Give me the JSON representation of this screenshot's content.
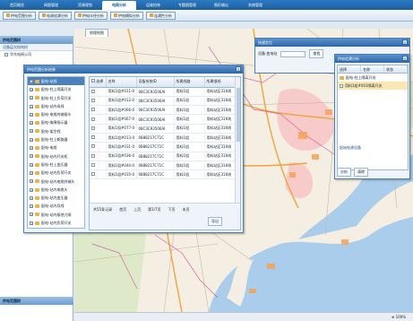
{
  "topnav": {
    "tabs": [
      {
        "label": "首页概览",
        "active": false
      },
      {
        "label": "网图管理",
        "active": false
      },
      {
        "label": "资源规划",
        "active": false
      },
      {
        "label": "电网分析",
        "active": true
      },
      {
        "label": "运维检修",
        "active": false
      },
      {
        "label": "专题图管理",
        "active": false
      },
      {
        "label": "图形输出",
        "active": false
      },
      {
        "label": "系统管理",
        "active": false
      }
    ]
  },
  "subbar": {
    "buttons": [
      "供电范围分析",
      "电源追溯分析",
      "供电半径分析",
      "供电模拟分析",
      "连通性分析"
    ]
  },
  "leftpanel": {
    "title": "供电范围树",
    "sub": "设备层次结构树",
    "item": "华东电网公司",
    "footer": "供电范围树"
  },
  "map": {
    "tab": "地理地图",
    "zoom": "100%"
  },
  "main_dialog": {
    "title": "供电范围分析结果",
    "tree": [
      {
        "label": "配电-站线",
        "selected": true
      },
      {
        "label": "配电-柱上隔离开关",
        "selected": false
      },
      {
        "label": "配电-柱上负荷开关",
        "selected": false
      },
      {
        "label": "配电-站内母线",
        "selected": false
      },
      {
        "label": "配电-电缆终端接头",
        "selected": false
      },
      {
        "label": "配电-故障指示器",
        "selected": false
      },
      {
        "label": "配电-架空线",
        "selected": false
      },
      {
        "label": "配电-柱上断路器",
        "selected": false
      },
      {
        "label": "配电-电缆",
        "selected": false
      },
      {
        "label": "配电-站内开关柜",
        "selected": false
      },
      {
        "label": "配电-柱上变压器",
        "selected": false
      },
      {
        "label": "配电-站内负荷开关",
        "selected": false
      },
      {
        "label": "配电-站内电缆终端头",
        "selected": false
      },
      {
        "label": "配电-站内电缆头",
        "selected": false
      },
      {
        "label": "配电-站内变压器",
        "selected": false
      },
      {
        "label": "配电-站内导线",
        "selected": false
      },
      {
        "label": "配电-站内接地刀闸",
        "selected": false
      },
      {
        "label": "配电-站内负荷开关",
        "selected": false
      }
    ],
    "columns": [
      "选择",
      "名称",
      "设备系统ID",
      "所属线路",
      "所属馈线"
    ],
    "rows": [
      [
        "用料1组#011-0",
        "08C3C93506AI",
        "用料1组",
        "用料站区316线"
      ],
      [
        "用料1组#012-0",
        "08C3C93506AI",
        "用料1组",
        "用料站区316线"
      ],
      [
        "用料1组#066-0",
        "08C3C93506AI",
        "用料1组",
        "用料站区316线"
      ],
      [
        "用料1组#067-0",
        "08C3C93506AI",
        "用料1组",
        "用料站区316线"
      ],
      [
        "用料1组#077-0",
        "08C3C93506AI",
        "用料1组",
        "用料站区316线"
      ],
      [
        "用料1组#013-0",
        "0888217C71C",
        "用料1组",
        "用料站区316线"
      ],
      [
        "用料1组#031-0",
        "0888217C71C",
        "用料1组",
        "用料站区316线"
      ],
      [
        "用料1组#036-0",
        "0888217C71C",
        "用料1组",
        "用料站区316线"
      ],
      [
        "用料1组#040-0",
        "0888217C71C",
        "用料1组",
        "用料站区316线"
      ],
      [
        "用料1组#035-0",
        "0888217C71C",
        "用料1组",
        "用料站区316线"
      ]
    ],
    "pager": {
      "total": "共55条记录",
      "first": "首页",
      "prev": "上页",
      "page": "第1/7页",
      "next": "下页",
      "last": "末页",
      "export": "导出"
    }
  },
  "right_dialog_1": {
    "title": "快速定位",
    "label": "设备:变电站",
    "button": "查找"
  },
  "right_dialog_2": {
    "title": "供电追溯分析",
    "columns": [
      "选择",
      "名称",
      "状态"
    ],
    "rows": [
      {
        "label": "配电-柱上隔离开关",
        "selected": false
      },
      {
        "label": "用料1组#001隔离开关",
        "selected": true
      }
    ],
    "buttons": [
      "分析",
      "清除"
    ],
    "link": "起始电源设备"
  }
}
